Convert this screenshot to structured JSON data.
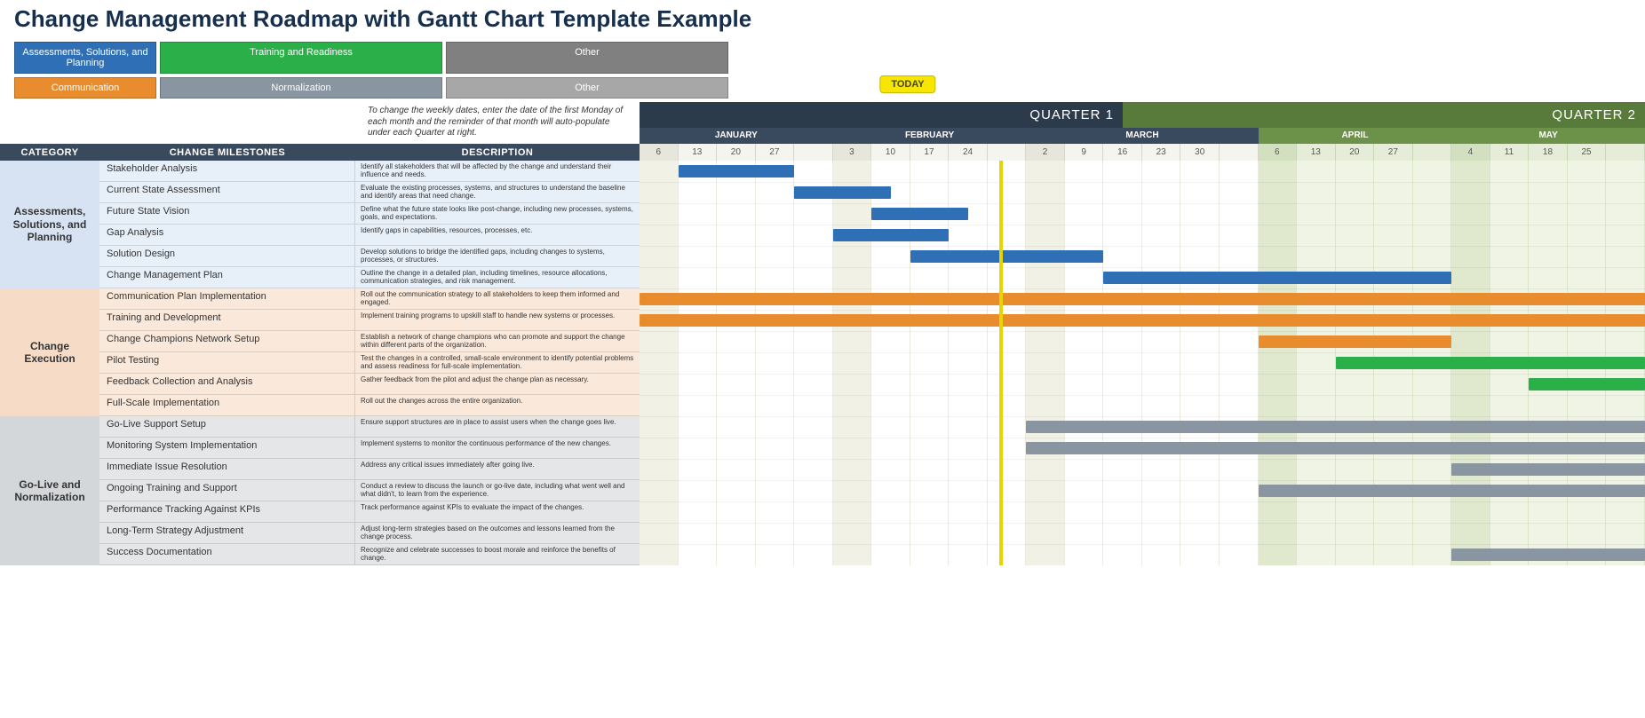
{
  "title": "Change Management Roadmap with Gantt Chart Template Example",
  "note": "To change the weekly dates, enter the date of the first Monday of each month and the reminder of that month will auto-populate under each Quarter at right.",
  "legend": [
    {
      "label": "Assessments, Solutions, and Planning",
      "color": "#2f6fb5"
    },
    {
      "label": "Training and Readiness",
      "color": "#2aaf49"
    },
    {
      "label": "Other",
      "color": "#808080"
    },
    {
      "label": "Communication",
      "color": "#e88c2e"
    },
    {
      "label": "Normalization",
      "color": "#8996a1"
    },
    {
      "label": "Other",
      "color": "#a7a7a7"
    }
  ],
  "today_label": "TODAY",
  "columns": {
    "category": "CATEGORY",
    "milestones": "CHANGE MILESTONES",
    "description": "DESCRIPTION"
  },
  "quarters": [
    {
      "name": "QUARTER 1",
      "class": "q1"
    },
    {
      "name": "QUARTER 2",
      "class": "q2"
    }
  ],
  "months": [
    {
      "name": "JANUARY",
      "weeks": 5,
      "q": 1
    },
    {
      "name": "FEBRUARY",
      "weeks": 5,
      "q": 1
    },
    {
      "name": "MARCH",
      "weeks": 6,
      "q": 1
    },
    {
      "name": "APRIL",
      "weeks": 5,
      "q": 2
    },
    {
      "name": "MAY",
      "weeks": 5,
      "q": 2
    }
  ],
  "weeks": [
    {
      "lbl": "6",
      "q": 1,
      "m0": true
    },
    {
      "lbl": "13",
      "q": 1
    },
    {
      "lbl": "20",
      "q": 1
    },
    {
      "lbl": "27",
      "q": 1
    },
    {
      "lbl": "",
      "q": 1
    },
    {
      "lbl": "3",
      "q": 1,
      "m0": true
    },
    {
      "lbl": "10",
      "q": 1
    },
    {
      "lbl": "17",
      "q": 1
    },
    {
      "lbl": "24",
      "q": 1
    },
    {
      "lbl": "",
      "q": 1
    },
    {
      "lbl": "2",
      "q": 1,
      "m0": true
    },
    {
      "lbl": "9",
      "q": 1
    },
    {
      "lbl": "16",
      "q": 1
    },
    {
      "lbl": "23",
      "q": 1
    },
    {
      "lbl": "30",
      "q": 1
    },
    {
      "lbl": "",
      "q": 1
    },
    {
      "lbl": "6",
      "q": 2,
      "m0": true
    },
    {
      "lbl": "13",
      "q": 2
    },
    {
      "lbl": "20",
      "q": 2
    },
    {
      "lbl": "27",
      "q": 2
    },
    {
      "lbl": "",
      "q": 2
    },
    {
      "lbl": "4",
      "q": 2,
      "m0": true
    },
    {
      "lbl": "11",
      "q": 2
    },
    {
      "lbl": "18",
      "q": 2
    },
    {
      "lbl": "25",
      "q": 2
    },
    {
      "lbl": "",
      "q": 2
    }
  ],
  "categories": [
    {
      "name": "Assessments, Solutions, and Planning",
      "tint": "t-a",
      "rows": [
        {
          "milestone": "Stakeholder Analysis",
          "desc": "Identify all stakeholders that will be affected by the change and understand their influence and needs."
        },
        {
          "milestone": "Current State Assessment",
          "desc": "Evaluate the existing processes, systems, and structures to understand the baseline and identify areas that need change."
        },
        {
          "milestone": "Future State Vision",
          "desc": "Define what the future state looks like post-change, including new processes, systems, goals, and expectations."
        },
        {
          "milestone": "Gap Analysis",
          "desc": "Identify gaps in capabilities, resources, processes, etc."
        },
        {
          "milestone": "Solution Design",
          "desc": "Develop solutions to bridge the identified gaps, including changes to systems, processes, or structures."
        },
        {
          "milestone": "Change Management Plan",
          "desc": "Outline the change in a detailed plan, including timelines, resource allocations, communication strategies, and risk management."
        }
      ]
    },
    {
      "name": "Change Execution",
      "tint": "t-b",
      "rows": [
        {
          "milestone": "Communication Plan Implementation",
          "desc": "Roll out the communication strategy to all stakeholders to keep them informed and engaged."
        },
        {
          "milestone": "Training and Development",
          "desc": "Implement training programs to upskill staff to handle new systems or processes."
        },
        {
          "milestone": "Change Champions Network Setup",
          "desc": "Establish a network of change champions who can promote and support the change within different parts of the organization."
        },
        {
          "milestone": "Pilot Testing",
          "desc": "Test the changes in a controlled, small-scale environment to identify potential problems and assess readiness for full-scale implementation."
        },
        {
          "milestone": "Feedback Collection and Analysis",
          "desc": "Gather feedback from the pilot and adjust the change plan as necessary."
        },
        {
          "milestone": "Full-Scale Implementation",
          "desc": "Roll out the changes across the entire organization."
        }
      ]
    },
    {
      "name": "Go-Live and Normalization",
      "tint": "t-c",
      "rows": [
        {
          "milestone": "Go-Live Support Setup",
          "desc": "Ensure support structures are in place to assist users when the change goes live."
        },
        {
          "milestone": "Monitoring System Implementation",
          "desc": "Implement systems to monitor the continuous performance of the new changes."
        },
        {
          "milestone": "Immediate Issue Resolution",
          "desc": "Address any critical issues immediately after going live."
        },
        {
          "milestone": "Ongoing Training and Support",
          "desc": "Conduct a review to discuss the launch or go-live date, including what went well and what didn't, to learn from the experience."
        },
        {
          "milestone": "Performance Tracking Against KPIs",
          "desc": "Track performance against KPIs to evaluate the impact of the changes."
        },
        {
          "milestone": "Long-Term Strategy Adjustment",
          "desc": "Adjust long-term strategies based on the outcomes and lessons learned from the change process."
        },
        {
          "milestone": "Success Documentation",
          "desc": "Recognize and celebrate successes to boost morale and reinforce the benefits of change."
        }
      ]
    }
  ],
  "chart_data": {
    "type": "gantt",
    "x_unit": "week-column (0-based across Q1+Q2)",
    "today_col": 9.3,
    "colors": {
      "planning": "#2f6fb5",
      "communication": "#e88c2e",
      "training": "#2aaf49",
      "normalization": "#8996a1"
    },
    "tasks": [
      {
        "row": 0,
        "start": 1,
        "end": 4,
        "color": "planning"
      },
      {
        "row": 1,
        "start": 4,
        "end": 6.5,
        "color": "planning"
      },
      {
        "row": 2,
        "start": 6,
        "end": 8.5,
        "color": "planning"
      },
      {
        "row": 3,
        "start": 5,
        "end": 8,
        "color": "planning"
      },
      {
        "row": 4,
        "start": 7,
        "end": 12,
        "color": "planning"
      },
      {
        "row": 5,
        "start": 12,
        "end": 21,
        "color": "planning"
      },
      {
        "row": 6,
        "start": 0,
        "end": 26,
        "color": "communication"
      },
      {
        "row": 7,
        "start": 0,
        "end": 26,
        "color": "communication"
      },
      {
        "row": 8,
        "start": 16,
        "end": 21,
        "color": "communication"
      },
      {
        "row": 9,
        "start": 18,
        "end": 26,
        "color": "training"
      },
      {
        "row": 10,
        "start": 23,
        "end": 26,
        "color": "training"
      },
      {
        "row": 12,
        "start": 10,
        "end": 26,
        "color": "normalization"
      },
      {
        "row": 13,
        "start": 10,
        "end": 26,
        "color": "normalization"
      },
      {
        "row": 14,
        "start": 21,
        "end": 26,
        "color": "normalization"
      },
      {
        "row": 15,
        "start": 16,
        "end": 26,
        "color": "normalization"
      },
      {
        "row": 18,
        "start": 21,
        "end": 26,
        "color": "normalization"
      }
    ]
  }
}
